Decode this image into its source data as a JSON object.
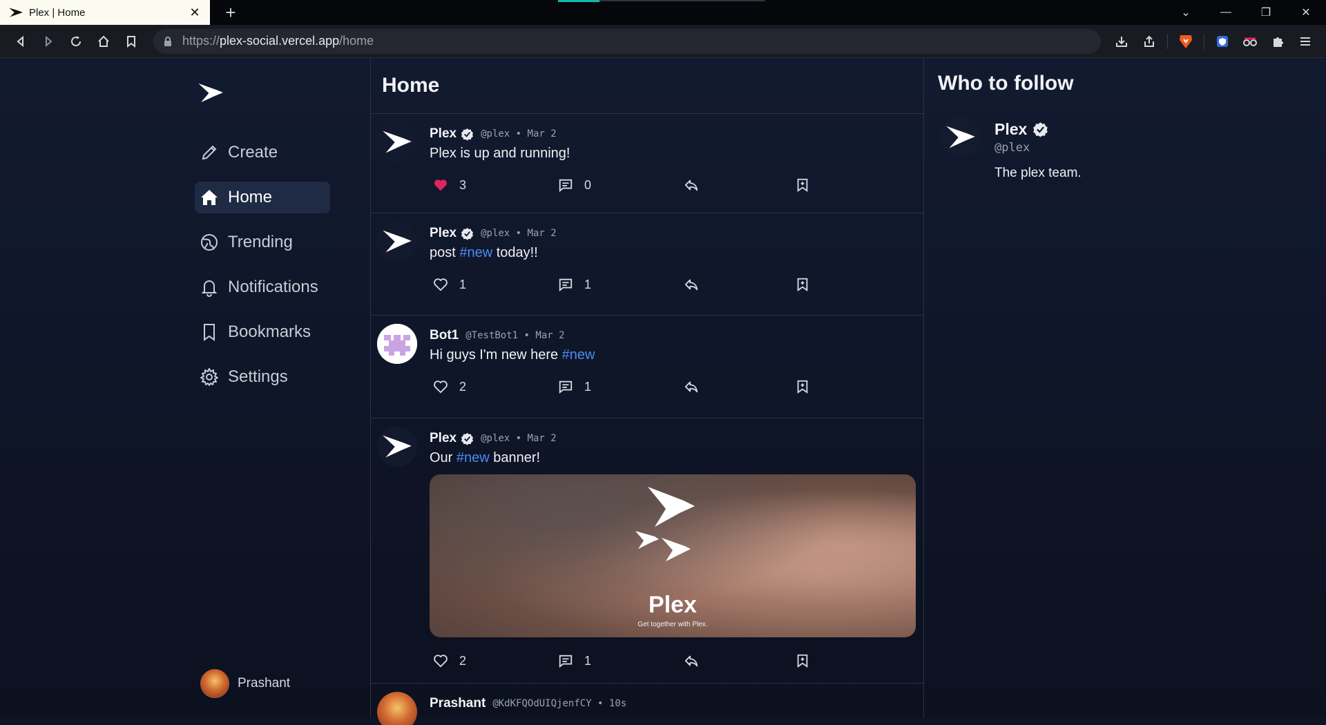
{
  "browser": {
    "tab_title": "Plex | Home",
    "url_prefix": "https://",
    "url_domain": "plex-social.vercel.app",
    "url_path": "/home"
  },
  "nav": {
    "items": [
      {
        "label": "Create",
        "icon": "pencil-icon"
      },
      {
        "label": "Home",
        "icon": "home-icon",
        "active": true
      },
      {
        "label": "Trending",
        "icon": "globe-icon"
      },
      {
        "label": "Notifications",
        "icon": "bell-icon"
      },
      {
        "label": "Bookmarks",
        "icon": "bookmark-icon"
      },
      {
        "label": "Settings",
        "icon": "gear-icon"
      }
    ],
    "user_name": "Prashant"
  },
  "feed": {
    "title": "Home",
    "posts": [
      {
        "name": "Plex",
        "handle": "@plex",
        "date": "Mar 2",
        "text": "Plex is up and running!",
        "likes": "3",
        "replies": "0",
        "liked": true
      },
      {
        "name": "Plex",
        "handle": "@plex",
        "date": "Mar 2",
        "text_before": "post ",
        "tag": "#new",
        "text_after": " today!!",
        "likes": "1",
        "replies": "1"
      },
      {
        "name": "Bot1",
        "handle": "@TestBot1",
        "date": "Mar 2",
        "text_before": "Hi guys I'm new here ",
        "tag": "#new",
        "likes": "2",
        "replies": "1"
      },
      {
        "name": "Plex",
        "handle": "@plex",
        "date": "Mar 2",
        "text_before": "Our ",
        "tag": "#new",
        "text_after": " banner!",
        "banner_wordmark": "Plex",
        "banner_tagline": "Get together with Plex.",
        "likes": "2",
        "replies": "1"
      },
      {
        "name": "Prashant",
        "handle": "@KdKFQOdUIQjenfCY",
        "date": "10s"
      }
    ]
  },
  "who_to_follow": {
    "title": "Who to follow",
    "name": "Plex",
    "handle": "@plex",
    "bio": "The plex team."
  },
  "colors": {
    "accent": "#4a8bf0",
    "like_red": "#e0245e",
    "background": "#0f1424"
  }
}
